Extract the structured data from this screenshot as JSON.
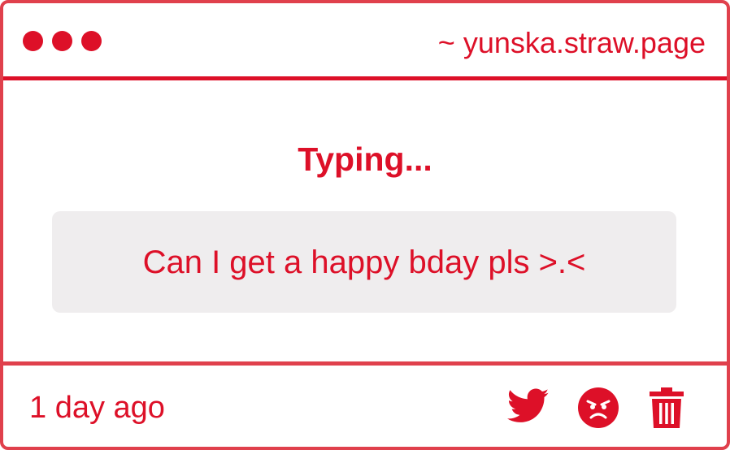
{
  "window": {
    "url": "~ yunska.straw.page",
    "controls": [
      "dot",
      "dot",
      "dot"
    ]
  },
  "main": {
    "heading": "Typing...",
    "message": "Can I get a happy bday pls >.<"
  },
  "footer": {
    "timestamp": "1 day ago",
    "actions": [
      {
        "icon": "twitter-icon"
      },
      {
        "icon": "angry-face-icon"
      },
      {
        "icon": "trash-icon"
      }
    ]
  },
  "colors": {
    "accent": "#dd1028",
    "border": "#e0404c",
    "message_bg": "#efedee",
    "background": "#ffffff"
  }
}
